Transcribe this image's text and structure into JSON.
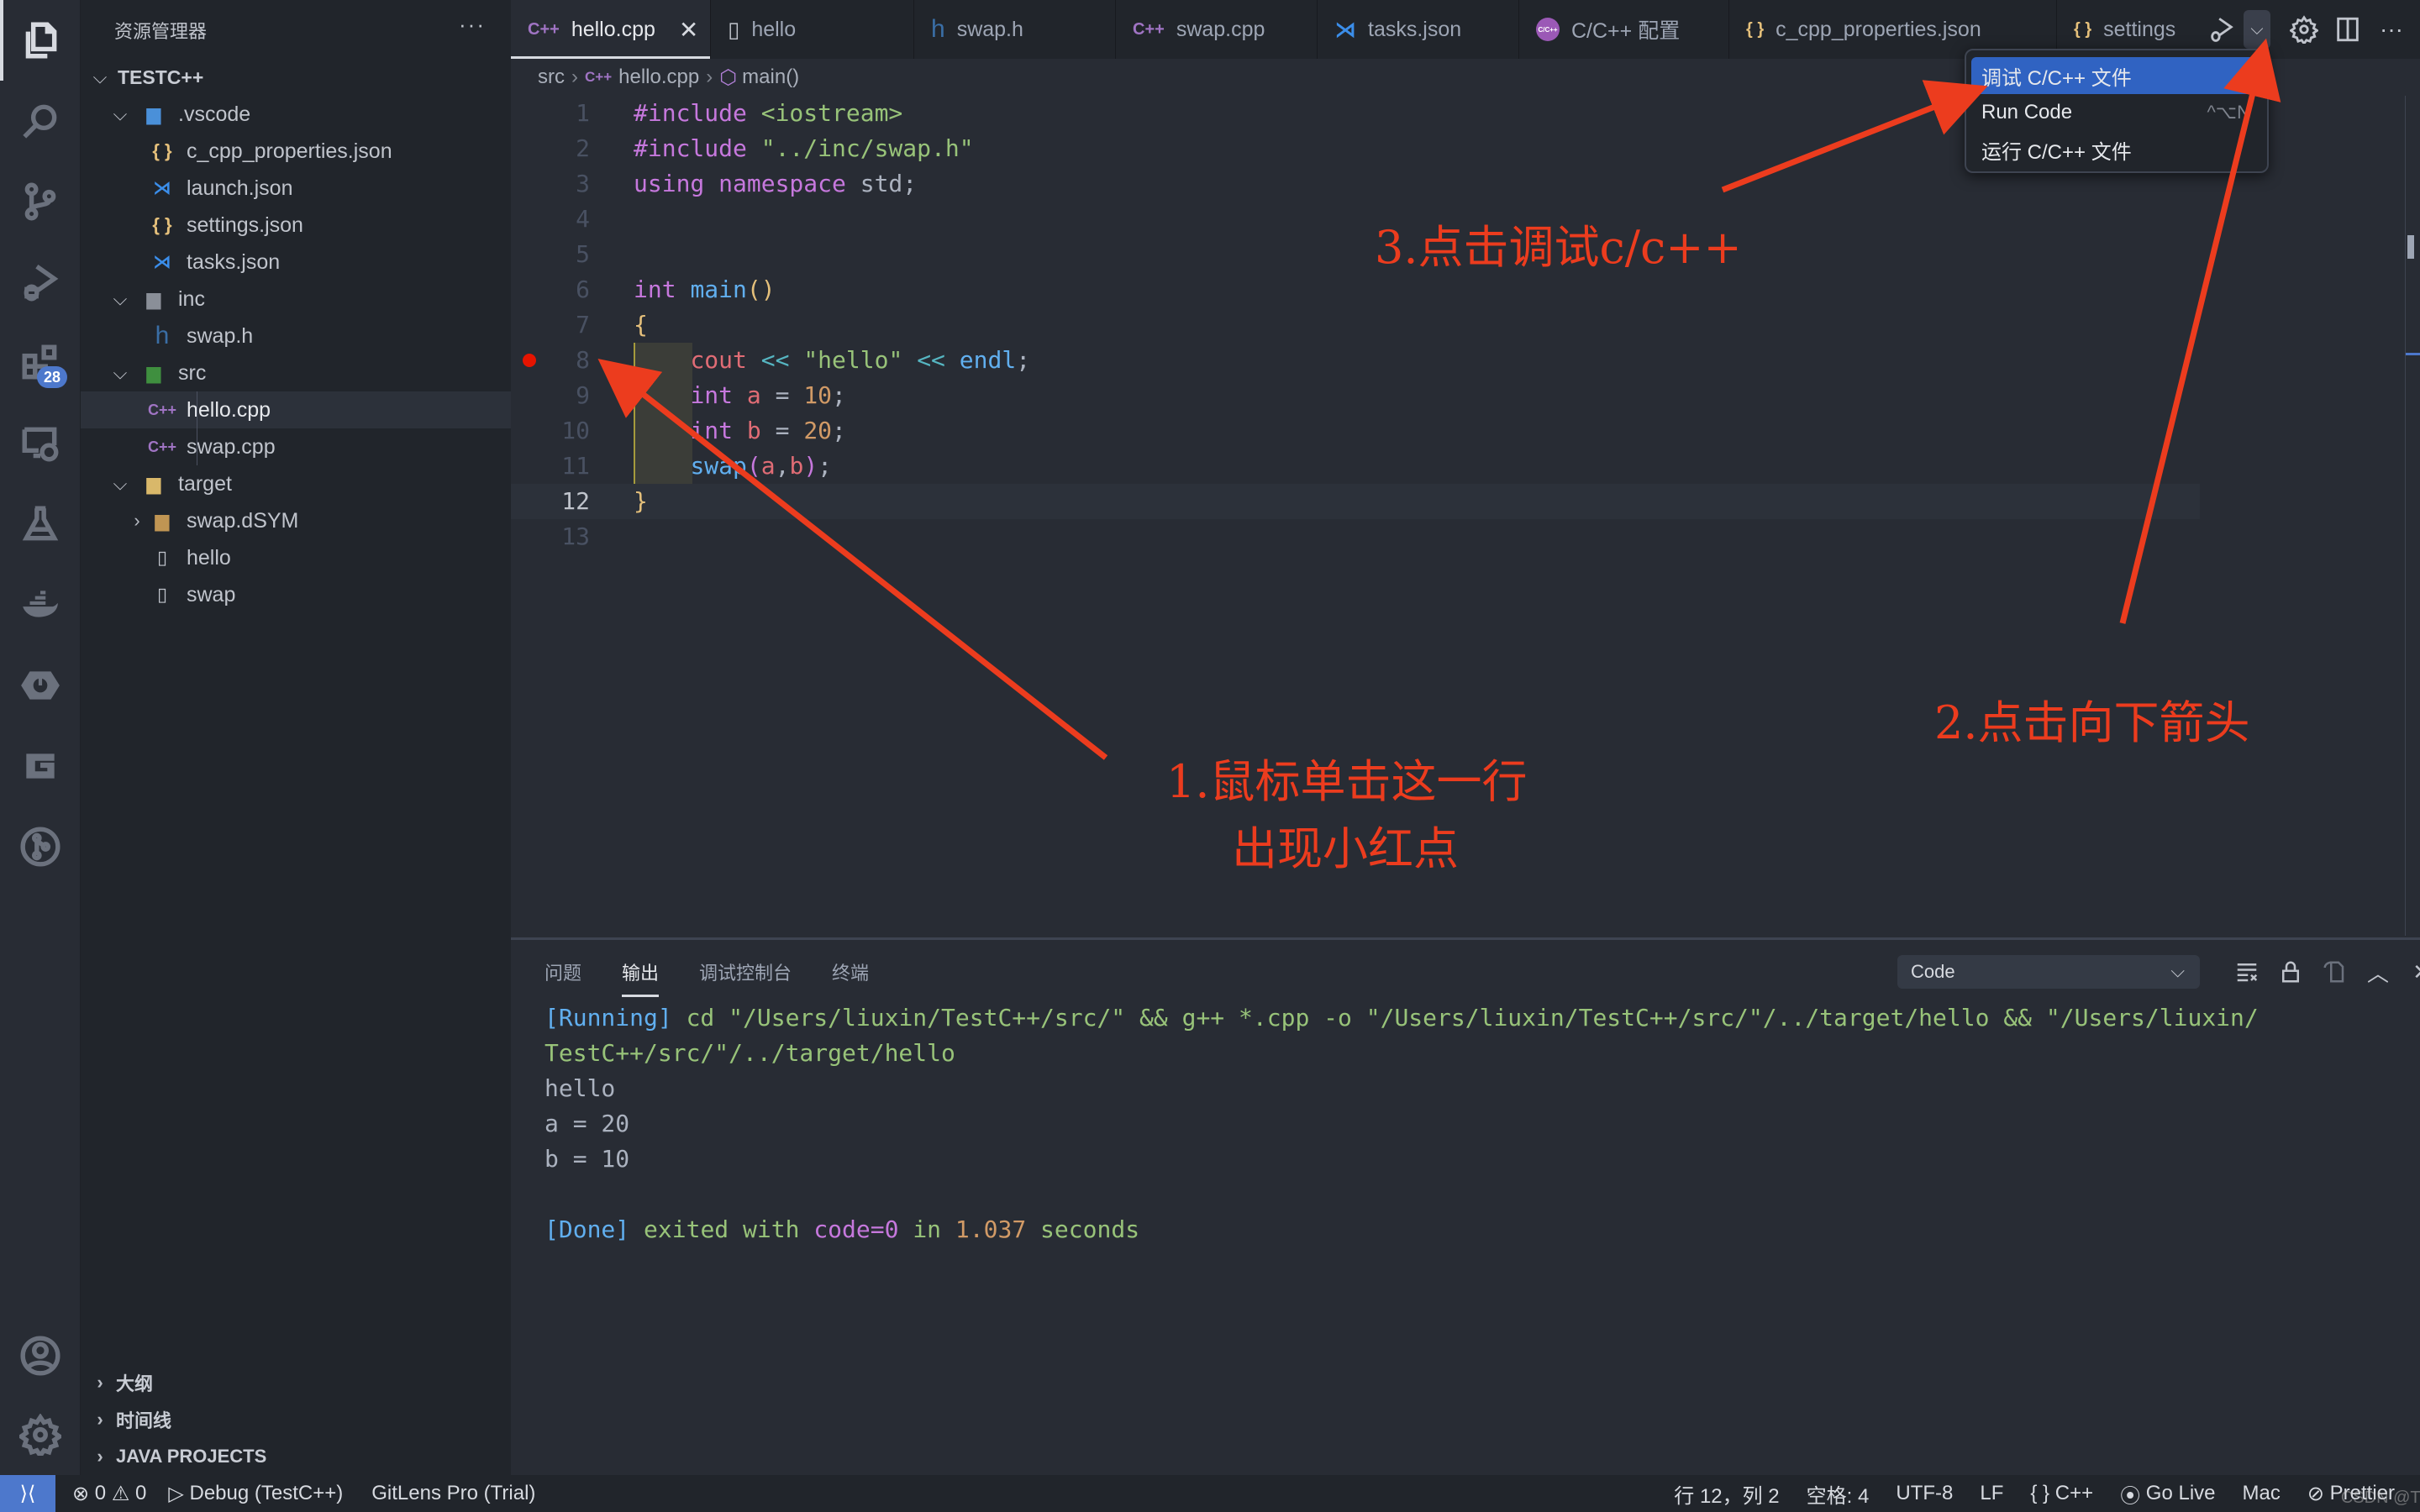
{
  "activity_bar": {
    "items": [
      {
        "name": "explorer",
        "active": true
      },
      {
        "name": "search"
      },
      {
        "name": "source-control"
      },
      {
        "name": "run-debug"
      },
      {
        "name": "extensions",
        "badge": "28"
      },
      {
        "name": "remote-explorer"
      },
      {
        "name": "testing"
      },
      {
        "name": "docker"
      },
      {
        "name": "spring-boot"
      },
      {
        "name": "gitlens"
      },
      {
        "name": "git-graph"
      }
    ],
    "bottom": [
      {
        "name": "accounts"
      },
      {
        "name": "manage"
      }
    ]
  },
  "sidebar": {
    "title": "资源管理器",
    "more": "···",
    "root": "TESTC++",
    "tree": [
      {
        "label": ".vscode",
        "type": "folder",
        "depth": 1,
        "expanded": true,
        "icon": "vscode-folder"
      },
      {
        "label": "c_cpp_properties.json",
        "type": "file",
        "depth": 2,
        "icon": "json"
      },
      {
        "label": "launch.json",
        "type": "file",
        "depth": 2,
        "icon": "vscode"
      },
      {
        "label": "settings.json",
        "type": "file",
        "depth": 2,
        "icon": "json"
      },
      {
        "label": "tasks.json",
        "type": "file",
        "depth": 2,
        "icon": "vscode"
      },
      {
        "label": "inc",
        "type": "folder",
        "depth": 1,
        "expanded": true,
        "icon": "include-folder"
      },
      {
        "label": "swap.h",
        "type": "file",
        "depth": 2,
        "icon": "h"
      },
      {
        "label": "src",
        "type": "folder",
        "depth": 1,
        "expanded": true,
        "icon": "src-folder"
      },
      {
        "label": "hello.cpp",
        "type": "file",
        "depth": 2,
        "icon": "cpp",
        "selected": true
      },
      {
        "label": "swap.cpp",
        "type": "file",
        "depth": 2,
        "icon": "cpp"
      },
      {
        "label": "target",
        "type": "folder",
        "depth": 1,
        "expanded": true,
        "icon": "target-folder"
      },
      {
        "label": "swap.dSYM",
        "type": "folder",
        "depth": 2,
        "expanded": false,
        "icon": "folder"
      },
      {
        "label": "hello",
        "type": "file",
        "depth": 2,
        "icon": "file"
      },
      {
        "label": "swap",
        "type": "file",
        "depth": 2,
        "icon": "file"
      }
    ],
    "sections": [
      "大纲",
      "时间线",
      "JAVA PROJECTS"
    ]
  },
  "tabs": [
    {
      "label": "hello.cpp",
      "icon": "cpp",
      "active": true,
      "close": "✕"
    },
    {
      "label": "hello",
      "icon": "file"
    },
    {
      "label": "swap.h",
      "icon": "h"
    },
    {
      "label": "swap.cpp",
      "icon": "cpp"
    },
    {
      "label": "tasks.json",
      "icon": "vscode"
    },
    {
      "label": "C/C++ 配置",
      "icon": "cpp-config"
    },
    {
      "label": "c_cpp_properties.json",
      "icon": "json"
    },
    {
      "label": "settings",
      "icon": "json"
    }
  ],
  "breadcrumb": [
    "src",
    "hello.cpp",
    "main()"
  ],
  "editor": {
    "current_line": 12,
    "breakpoint_line": 8,
    "lines": [
      {
        "n": "1",
        "tokens": [
          [
            "kw",
            "#include "
          ],
          [
            "str",
            "<iostream>"
          ]
        ]
      },
      {
        "n": "2",
        "tokens": [
          [
            "kw",
            "#include "
          ],
          [
            "str",
            "\"../inc/swap.h\""
          ]
        ]
      },
      {
        "n": "3",
        "tokens": [
          [
            "kw",
            "using namespace "
          ],
          [
            "pl",
            "std;"
          ]
        ]
      },
      {
        "n": "4",
        "tokens": []
      },
      {
        "n": "5",
        "tokens": []
      },
      {
        "n": "6",
        "tokens": [
          [
            "kw",
            "int "
          ],
          [
            "fn",
            "main"
          ],
          [
            "br",
            "()"
          ]
        ]
      },
      {
        "n": "7",
        "tokens": [
          [
            "br",
            "{"
          ]
        ]
      },
      {
        "n": "8",
        "tokens": [
          [
            "pl",
            "    "
          ],
          [
            "var",
            "cout"
          ],
          [
            "pl",
            " "
          ],
          [
            "op",
            "<<"
          ],
          [
            "pl",
            " "
          ],
          [
            "str",
            "\"hello\""
          ],
          [
            "pl",
            " "
          ],
          [
            "op",
            "<<"
          ],
          [
            "pl",
            " "
          ],
          [
            "fn",
            "endl"
          ],
          [
            "pl",
            ";"
          ]
        ]
      },
      {
        "n": "9",
        "tokens": [
          [
            "pl",
            "    "
          ],
          [
            "kw",
            "int "
          ],
          [
            "var",
            "a"
          ],
          [
            "pl",
            " = "
          ],
          [
            "num",
            "10"
          ],
          [
            "pl",
            ";"
          ]
        ]
      },
      {
        "n": "10",
        "tokens": [
          [
            "pl",
            "    "
          ],
          [
            "kw",
            "int "
          ],
          [
            "var",
            "b"
          ],
          [
            "pl",
            " = "
          ],
          [
            "num",
            "20"
          ],
          [
            "pl",
            ";"
          ]
        ]
      },
      {
        "n": "11",
        "tokens": [
          [
            "pl",
            "    "
          ],
          [
            "fn",
            "swap"
          ],
          [
            "kw",
            "("
          ],
          [
            "var",
            "a"
          ],
          [
            "pl",
            ","
          ],
          [
            "var",
            "b"
          ],
          [
            "kw",
            ")"
          ],
          [
            "pl",
            ";"
          ]
        ]
      },
      {
        "n": "12",
        "tokens": [
          [
            "br",
            "}"
          ]
        ]
      },
      {
        "n": "13",
        "tokens": []
      }
    ]
  },
  "run_menu": {
    "items": [
      {
        "label": "调试 C/C++ 文件",
        "highlighted": true
      },
      {
        "label": "Run Code",
        "shortcut": "^⌥N"
      },
      {
        "label": "运行 C/C++ 文件"
      }
    ]
  },
  "panel": {
    "tabs": [
      "问题",
      "输出",
      "调试控制台",
      "终端"
    ],
    "active_tab": "输出",
    "channel": "Code",
    "output": [
      [
        [
          "o-blue",
          "[Running]"
        ],
        [
          "o-green",
          " cd \"/Users/liuxin/TestC++/src/\" && g++ *.cpp -o \"/Users/liuxin/TestC++/src/\"/../target/hello && \"/Users/liuxin/"
        ]
      ],
      [
        [
          "o-green",
          "TestC++/src/\"/../target/hello"
        ]
      ],
      [
        [
          "",
          "hello"
        ]
      ],
      [
        [
          "",
          "a = 20"
        ]
      ],
      [
        [
          "",
          "b = 10"
        ]
      ],
      [
        [
          "",
          ""
        ]
      ],
      [
        [
          "o-blue",
          "[Done]"
        ],
        [
          "o-green",
          " exited with "
        ],
        [
          "o-purple",
          "code=0"
        ],
        [
          "o-green",
          " in "
        ],
        [
          "o-orange",
          "1.037"
        ],
        [
          "o-green",
          " seconds"
        ]
      ]
    ]
  },
  "statusbar": {
    "errors": "0",
    "warnings": "0",
    "debug": "Debug (TestC++)",
    "gitlens": "GitLens Pro (Trial)",
    "position": "行 12，列 2",
    "spaces": "空格: 4",
    "encoding": "UTF-8",
    "eol": "LF",
    "language": "C++",
    "golive": "Go Live",
    "platform": "Mac",
    "prettier": "Prettier",
    "watermark": "CSDN @Track 来者居上"
  },
  "annotations": {
    "step1_line1": "1.鼠标单击这一行",
    "step1_line2": "出现小红点",
    "step2": "2.点击向下箭头",
    "step3": "3.点击调试c/c++",
    "color": "#ec3c1e"
  }
}
